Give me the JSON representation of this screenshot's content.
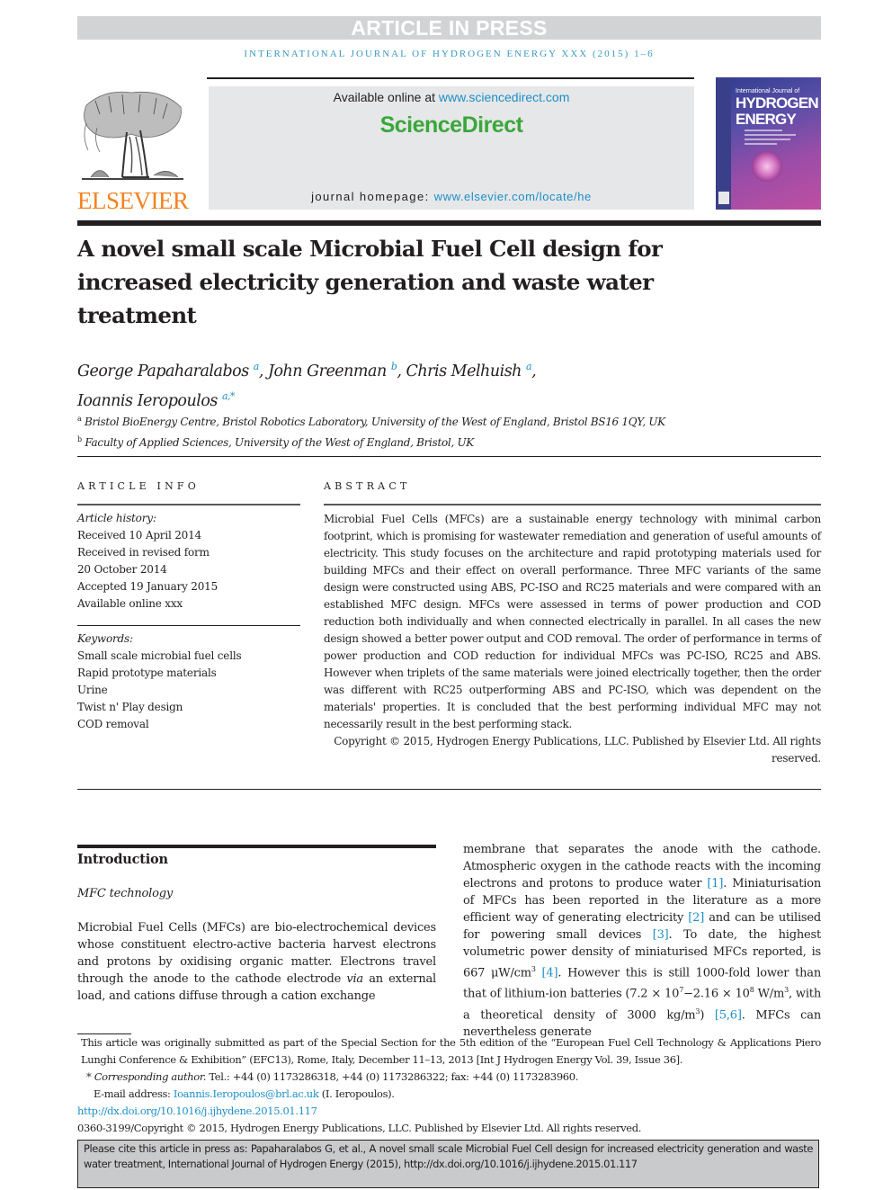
{
  "banner": {
    "text": "ARTICLE IN PRESS"
  },
  "running_head": "international journal of hydrogen energy xxx (2015) 1–6",
  "masthead": {
    "publisher_logo": "ELSEVIER",
    "available_prefix": "Available online at ",
    "available_link": "www.sciencedirect.com",
    "sciencedirect_logo": "ScienceDirect",
    "homepage_prefix": "journal homepage: ",
    "homepage_link": "www.elsevier.com/locate/he",
    "cover": {
      "line1": "International Journal of",
      "line2": "HYDROGEN",
      "line3": "ENERGY"
    }
  },
  "article": {
    "title": "A novel small scale Microbial Fuel Cell design for increased electricity generation and waste water treatment",
    "authors": [
      {
        "name": "George Papaharalabos",
        "aff": "a",
        "sep": ", "
      },
      {
        "name": "John Greenman",
        "aff": "b",
        "sep": ", "
      },
      {
        "name": "Chris Melhuish",
        "aff": "a",
        "sep": ","
      },
      {
        "name": "Ioannis Ieropoulos",
        "aff": "a,*",
        "sep": ""
      }
    ],
    "affiliations": [
      {
        "key": "a",
        "text": "Bristol BioEnergy Centre, Bristol Robotics Laboratory, University of the West of England, Bristol BS16 1QY, UK"
      },
      {
        "key": "b",
        "text": "Faculty of Applied Sciences, University of the West of England, Bristol, UK"
      }
    ]
  },
  "article_info": {
    "heading": "ARTICLE INFO",
    "history_label": "Article history:",
    "history": [
      "Received 10 April 2014",
      "Received in revised form",
      "20 October 2014",
      "Accepted 19 January 2015",
      "Available online xxx"
    ],
    "keywords_label": "Keywords:",
    "keywords": [
      "Small scale microbial fuel cells",
      "Rapid prototype materials",
      "Urine",
      "Twist n' Play design",
      "COD removal"
    ]
  },
  "abstract": {
    "heading": "ABSTRACT",
    "text": "Microbial Fuel Cells (MFCs) are a sustainable energy technology with minimal carbon footprint, which is promising for wastewater remediation and generation of useful amounts of electricity. This study focuses on the architecture and rapid prototyping materials used for building MFCs and their effect on overall performance. Three MFC variants of the same design were constructed using ABS, PC-ISO and RC25 materials and were compared with an established MFC design. MFCs were assessed in terms of power production and COD reduction both individually and when connected electrically in parallel. In all cases the new design showed a better power output and COD removal. The order of performance in terms of power production and COD reduction for individual MFCs was PC-ISO, RC25 and ABS. However when triplets of the same materials were joined electrically together, then the order was different with RC25 outperforming ABS and PC-ISO, which was dependent on the materials' properties. It is concluded that the best performing individual MFC may not necessarily result in the best performing stack.",
    "copyright": "Copyright © 2015, Hydrogen Energy Publications, LLC. Published by Elsevier Ltd. All rights reserved."
  },
  "body": {
    "section_heading": "Introduction",
    "subsection_heading": "MFC technology",
    "left_para": {
      "p1": "Microbial Fuel Cells (MFCs) are bio-electrochemical devices whose constituent electro-active bacteria harvest electrons and protons by oxidising organic matter. Electrons travel through the anode to the cathode electrode ",
      "via": "via",
      "p2": " an external load, and cations diffuse through a cation exchange"
    },
    "right_para": {
      "t1": "membrane that separates the anode with the cathode. Atmospheric oxygen in the cathode reacts with the incoming electrons and protons to produce water ",
      "r1": "[1]",
      "t2": ". Miniaturisation of MFCs has been reported in the literature as a more efficient way of generating electricity ",
      "r2": "[2]",
      "t3": " and can be utilised for powering small devices ",
      "r3": "[3]",
      "t4": ". To date, the highest volumetric power density of miniaturised MFCs reported, is 667 μW/cm",
      "sup3": "3",
      "r4": "[4]",
      "t5": ". However this is still 1000-fold lower than that of lithium-ion batteries (7.2 × 10",
      "sup7": "7",
      "t6": "−2.16 × 10",
      "sup8": "8",
      "t7": " W/m",
      "t8": ", with a theoretical density of 3000 kg/m",
      "t9": ") ",
      "r5": "[5,6]",
      "t10": ". MFCs can nevertheless generate"
    }
  },
  "footnotes": {
    "note1": "This article was originally submitted as part of the Special Section for the 5th edition of the “European Fuel Cell Technology & Applications Piero Lunghi Conference & Exhibition” (EFC13), Rome, Italy, December 11–13, 2013 [Int J Hydrogen Energy Vol. 39, Issue 36].",
    "corr_mark": "* ",
    "corr_label": "Corresponding author.",
    "corr_text": " Tel.: +44 (0) 1173286318, +44 (0) 1173286322; fax: +44 (0) 1173283960.",
    "email_label": "E-mail address: ",
    "email": "Ioannis.Ieropoulos@brl.ac.uk",
    "email_suffix": " (I. Ieropoulos).",
    "doi": "http://dx.doi.org/10.1016/j.ijhydene.2015.01.117",
    "issn_copyright": "0360-3199/Copyright © 2015, Hydrogen Energy Publications, LLC. Published by Elsevier Ltd. All rights reserved."
  },
  "citation_box": "Please cite this article in press as: Papaharalabos G, et al., A novel small scale Microbial Fuel Cell design for increased electricity generation and waste water treatment, International Journal of Hydrogen Energy (2015), http://dx.doi.org/10.1016/j.ijhydene.2015.01.117",
  "colors": {
    "link": "#1c8fc6",
    "elsevier_orange": "#f58220",
    "sciencedirect_green": "#3aa73a",
    "banner_grey": "#d2d3d4"
  }
}
